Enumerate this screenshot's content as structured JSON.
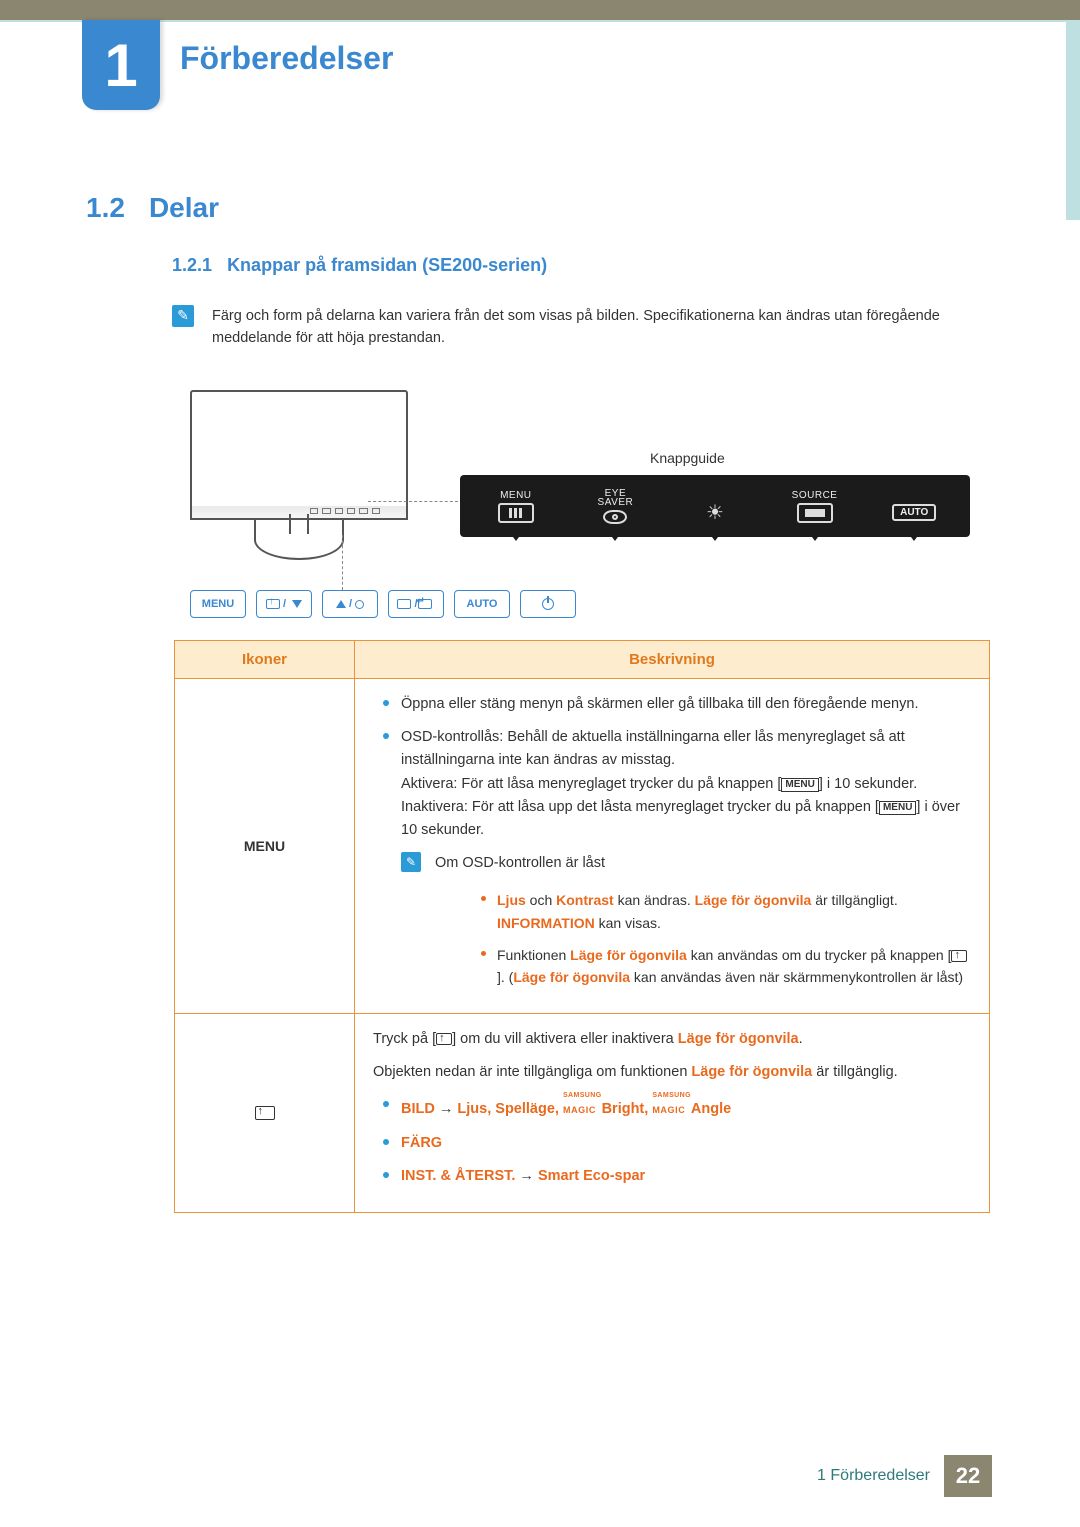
{
  "chapter": {
    "num": "1",
    "title": "Förberedelser"
  },
  "section": {
    "num": "1.2",
    "title": "Delar"
  },
  "subsection": {
    "num": "1.2.1",
    "title": "Knappar på framsidan (SE200-serien)"
  },
  "note1": "Färg och form på delarna kan variera från det som visas på bilden. Specifikationerna kan ändras utan föregående meddelande för att höja prestandan.",
  "fig": {
    "knappguide": "Knappguide",
    "osd": {
      "menu": "MENU",
      "eye1": "EYE",
      "eye2": "SAVER",
      "source": "SOURCE",
      "auto": "AUTO"
    },
    "phys": {
      "menu": "MENU",
      "auto": "AUTO"
    }
  },
  "table": {
    "head": {
      "ikoner": "Ikoner",
      "beskrivning": "Beskrivning"
    },
    "row1": {
      "icon": "MENU",
      "b1": "Öppna eller stäng menyn på skärmen eller gå tillbaka till den föregående menyn.",
      "b2a": "OSD-kontrollås: Behåll de aktuella inställningarna eller lås menyreglaget så att inställningarna inte kan ändras av misstag.",
      "b2b_pre": "Aktivera: För att låsa menyreglaget trycker du på knappen [",
      "b2b_mid": "] i 10 sekunder. Inaktivera: För att låsa upp det låsta menyreglaget trycker du på knappen [",
      "b2b_post": "] i över 10 sekunder.",
      "note": "Om OSD-kontrollen är låst",
      "s1_a": "Ljus",
      "s1_b": " och ",
      "s1_c": "Kontrast",
      "s1_d": " kan ändras. ",
      "s1_e": "Läge för ögonvila",
      "s1_f": " är tillgängligt. ",
      "s1_g": "INFORMATION",
      "s1_h": " kan visas.",
      "s2_a": "Funktionen ",
      "s2_b": "Läge för ögonvila",
      "s2_c": " kan användas om du trycker på knappen [",
      "s2_d": "]. (",
      "s2_e": "Läge för ögonvila",
      "s2_f": " kan användas även när skärmmenykontrollen är låst)"
    },
    "row2": {
      "p1_a": "Tryck på [",
      "p1_b": "] om du vill aktivera eller inaktivera ",
      "p1_c": "Läge för ögonvila",
      "p1_d": ".",
      "p2_a": "Objekten nedan är inte tillgängliga om funktionen ",
      "p2_b": "Läge för ögonvila",
      "p2_c": " är tillgänglig.",
      "b1_a": "BILD",
      "b1_arrow": " → ",
      "b1_b": "Ljus",
      "b1_c": ", ",
      "b1_d": "Spelläge",
      "b1_e": ", ",
      "b1_bright": "Bright",
      "b1_f": ", ",
      "b1_angle": "Angle",
      "b2": "FÄRG",
      "b3_a": "INST. & ÅTERST.",
      "b3_arrow": " → ",
      "b3_b": "Smart Eco-spar"
    }
  },
  "footer": {
    "text": "1 Förberedelser",
    "page": "22"
  },
  "samsung_magic": {
    "s": "SAMSUNG",
    "m": "MAGIC"
  },
  "menu_small": "MENU"
}
